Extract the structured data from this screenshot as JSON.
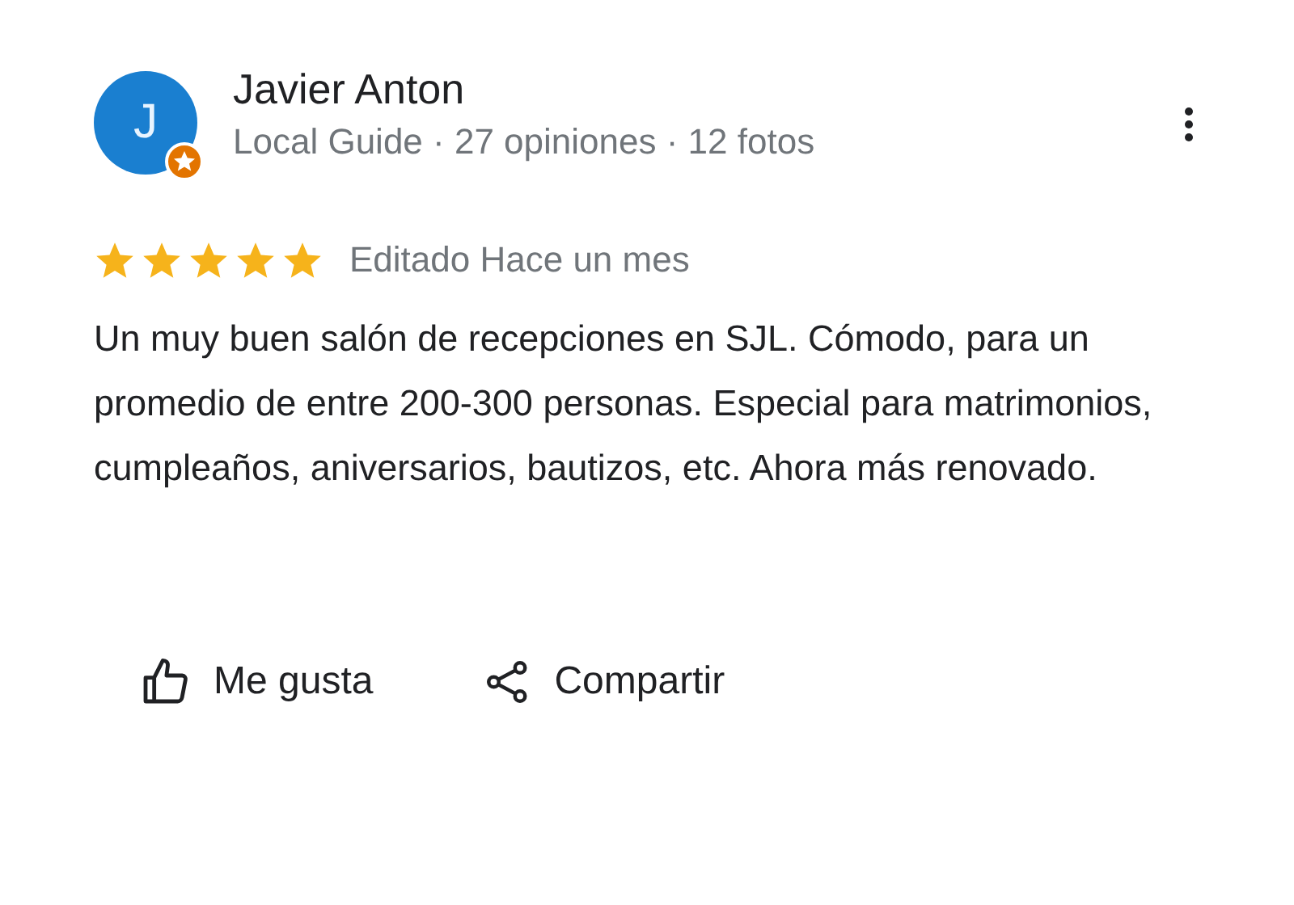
{
  "review": {
    "author": {
      "initial": "J",
      "name": "Javier Anton",
      "meta": "Local Guide · 27 opiniones · 12 fotos",
      "local_guide": true
    },
    "stars": 5,
    "date": "Editado Hace un mes",
    "text": "Un muy buen salón de recepciones en SJL. Cómodo, para un promedio de entre 200-300 personas. Especial para matrimonios, cumpleaños, aniversarios, bautizos, etc. Ahora más renovado.",
    "actions": [
      {
        "kind": "like",
        "label": "Me gusta"
      },
      {
        "kind": "share",
        "label": "Compartir"
      }
    ]
  }
}
